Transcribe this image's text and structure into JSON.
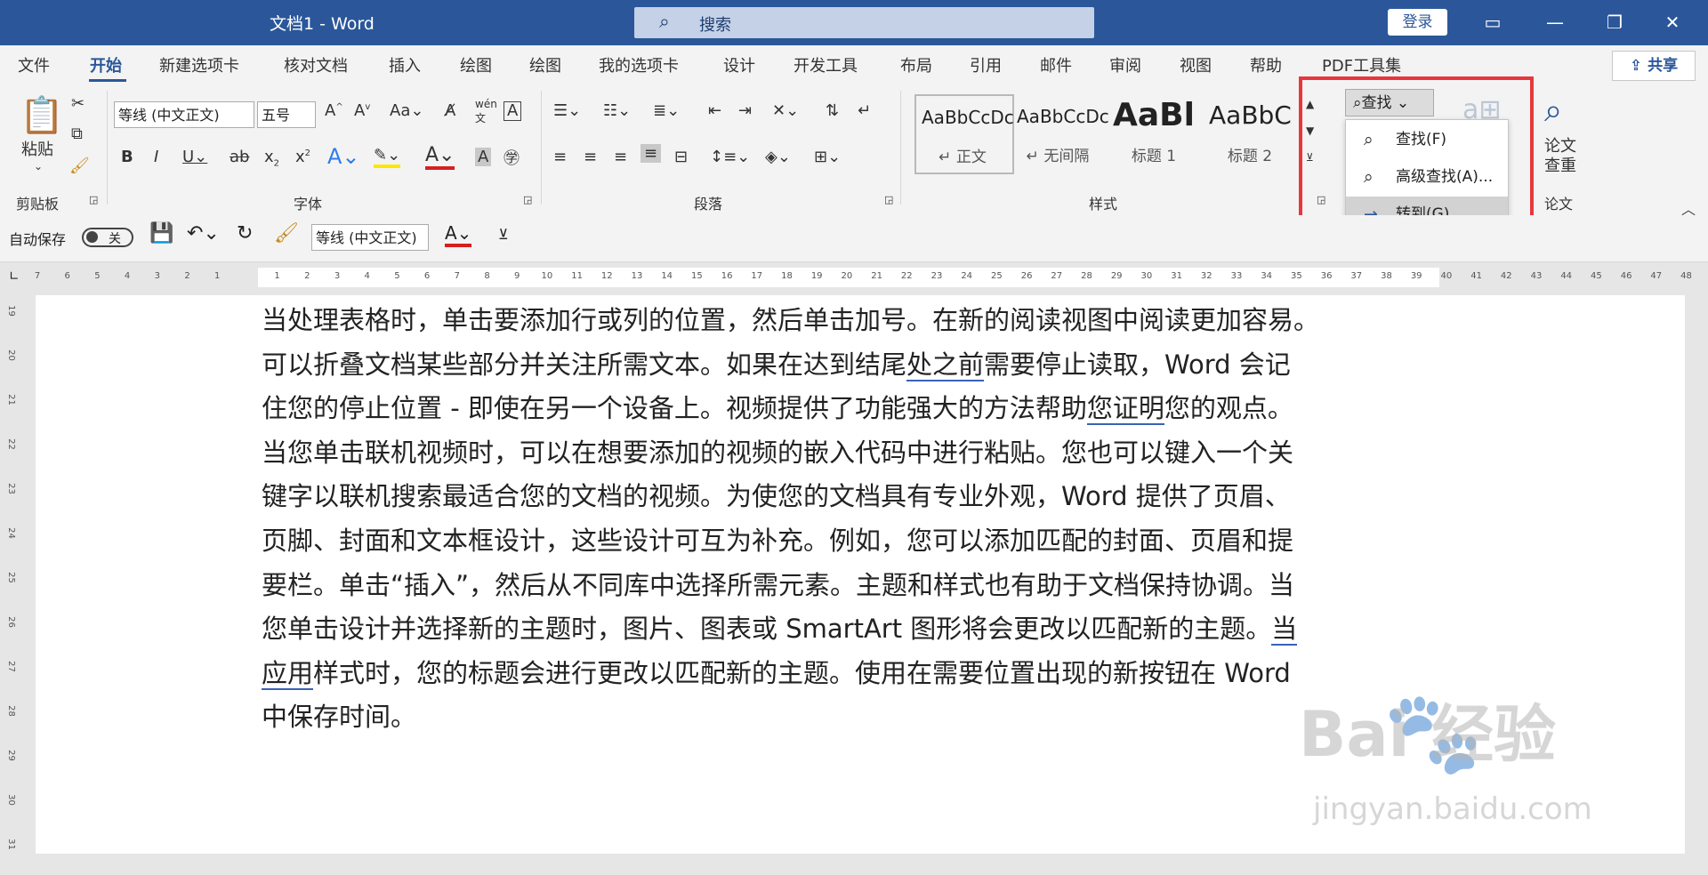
{
  "titlebar": {
    "doc_title": "文档1  -  Word",
    "search_placeholder": "搜索",
    "login": "登录"
  },
  "tabs": [
    "文件",
    "开始",
    "新建选项卡",
    "核对文档",
    "插入",
    "绘图",
    "绘图",
    "我的选项卡",
    "设计",
    "开发工具",
    "布局",
    "引用",
    "邮件",
    "审阅",
    "视图",
    "帮助",
    "PDF工具集"
  ],
  "share": "共享",
  "ribbon": {
    "clipboard": {
      "paste": "粘贴",
      "label": "剪贴板"
    },
    "font": {
      "font_name": "等线 (中文正文)",
      "font_size": "五号",
      "label": "字体"
    },
    "paragraph": {
      "label": "段落"
    },
    "styles": {
      "label": "样式",
      "items": [
        {
          "sample": "AaBbCcDc",
          "name": "↵ 正文"
        },
        {
          "sample": "AaBbCcDc",
          "name": "↵ 无间隔"
        },
        {
          "sample": "AaBl",
          "name": "标题 1"
        },
        {
          "sample": "AaBbC",
          "name": "标题 2"
        }
      ]
    },
    "find": {
      "button": "查找",
      "items": [
        "查找(F)",
        "高级查找(A)...",
        "转到(G)..."
      ]
    },
    "paper": {
      "check_label": "论文\n查重",
      "label": "论文"
    }
  },
  "qat": {
    "autosave": "自动保存",
    "toggle": "关",
    "font_name": "等线 (中文正文)"
  },
  "ruler_h": [
    "7",
    "6",
    "5",
    "4",
    "3",
    "2",
    "1",
    "",
    "1",
    "2",
    "3",
    "4",
    "5",
    "6",
    "7",
    "8",
    "9",
    "10",
    "11",
    "12",
    "13",
    "14",
    "15",
    "16",
    "17",
    "18",
    "19",
    "20",
    "21",
    "22",
    "23",
    "24",
    "25",
    "26",
    "27",
    "28",
    "29",
    "30",
    "31",
    "32",
    "33",
    "34",
    "35",
    "36",
    "37",
    "38",
    "39",
    "40",
    "41",
    "42",
    "43",
    "44",
    "45",
    "46",
    "47",
    "48"
  ],
  "ruler_v": [
    "19",
    "20",
    "21",
    "22",
    "23",
    "24",
    "25",
    "26",
    "27",
    "28",
    "29",
    "30",
    "31"
  ],
  "document": {
    "lines": [
      [
        "当处理表格时，单击要添加行或列的位置，然后单击加号。在新的阅读视图中阅读更加容易。"
      ],
      [
        "可以折叠文档某些部分并关注所需文本。如果在达到结尾",
        {
          "u": "blue",
          "t": "处之前"
        },
        "需要停止读取，Word 会记"
      ],
      [
        "住您的停止位置 - 即使在另一个设备上。视频提供了功能强大的方法帮助",
        {
          "u": "blue",
          "t": "您证明"
        },
        "您的观点。"
      ],
      [
        "当您单击联机视频时，可以在想要添加的视频的嵌入代码中进行粘贴。您也可以键入一个关"
      ],
      [
        "键字以联机搜索最适合您的文档的视频。为使您的文档具有专业外观，Word 提供了页眉、"
      ],
      [
        "页脚、封面和文本框设计，这些设计可互为补充。例如，您可以添加匹配的封面、页眉和提"
      ],
      [
        "要栏。单击“插入”，然后从不同库中选择所需元素。主题和样式也有助于文档保持协调。当"
      ],
      [
        "您单击设计并选择新的主题时，图片、图表或 SmartArt 图形将会更改以匹配新的主题。",
        {
          "u": "blue",
          "t": "当"
        }
      ],
      [
        {
          "u": "blue",
          "t": "应用"
        },
        "样式时，您的标题会进行更改以匹配新的主题。使用在需要位置出现的新按钮在 Word"
      ],
      [
        "中保存时间。"
      ]
    ]
  },
  "watermark": {
    "brand": "Bai 经验",
    "url": "jingyan.baidu.com"
  }
}
